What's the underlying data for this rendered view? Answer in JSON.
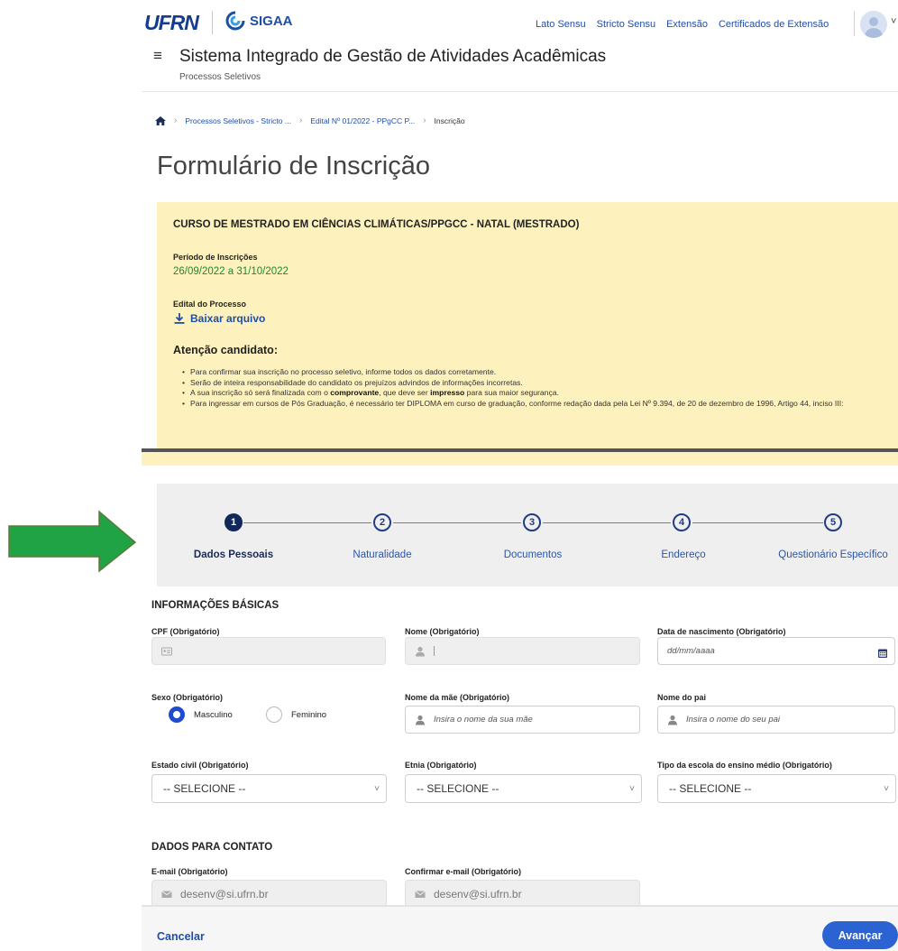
{
  "header": {
    "logo_ufrn": "UFRN",
    "logo_sigaa": "SIGAA",
    "nav_links": [
      "Lato Sensu",
      "Stricto Sensu",
      "Extensão",
      "Certificados de Extensão"
    ],
    "menu_glyph": "≡",
    "system_title": "Sistema Integrado de Gestão de Atividades Acadêmicas",
    "system_subtitle": "Processos Seletivos",
    "avatar_chevron": "˅"
  },
  "breadcrumb": {
    "items": [
      "Processos Seletivos - Stricto ...",
      "Edital Nº 01/2022 - PPgCC P...",
      "Inscrição"
    ]
  },
  "page_title": "Formulário de Inscrição",
  "notice": {
    "course": "CURSO DE MESTRADO EM CIÊNCIAS CLIMÁTICAS/PPGCC - NATAL (MESTRADO)",
    "period_label": "Período de Inscrições",
    "period_value": "26/09/2022 a 31/10/2022",
    "edital_label": "Edital do Processo",
    "download_label": "Baixar arquivo",
    "attention_title": "Atenção candidato:",
    "bullets": {
      "b1": "Para confirmar sua inscrição no processo seletivo, informe todos os dados corretamente.",
      "b2": "Serão de inteira responsabilidade do candidato os prejuízos advindos de informações incorretas.",
      "b3_pre": "A sua inscrição só será finalizada com o ",
      "b3_strong1": "comprovante",
      "b3_mid": ", que deve ser ",
      "b3_strong2": "impresso",
      "b3_post": " para sua maior segurança.",
      "b4": "Para ingressar em cursos de Pós Graduação, é necessário ter DIPLOMA em curso de graduação, conforme redação dada pela Lei Nº 9.394, de 20 de dezembro de 1996, Artigo 44, inciso III:"
    }
  },
  "stepper": {
    "steps": [
      {
        "number": "1",
        "label": "Dados Pessoais",
        "active": true
      },
      {
        "number": "2",
        "label": "Naturalidade",
        "active": false
      },
      {
        "number": "3",
        "label": "Documentos",
        "active": false
      },
      {
        "number": "4",
        "label": "Endereço",
        "active": false
      },
      {
        "number": "5",
        "label": "Questionário Específico",
        "active": false
      }
    ]
  },
  "form": {
    "basic_title": "INFORMAÇÕES BÁSICAS",
    "cpf_label": "CPF (Obrigatório)",
    "nome_label": "Nome (Obrigatório)",
    "nascimento_label": "Data de nascimento (Obrigatório)",
    "nascimento_placeholder": "dd/mm/aaaa",
    "sexo_label": "Sexo (Obrigatório)",
    "sexo_options": [
      "Masculino",
      "Feminino"
    ],
    "sexo_selected": "Masculino",
    "mae_label": "Nome da mãe (Obrigatório)",
    "mae_placeholder": "Insira o nome da sua mãe",
    "pai_label": "Nome do pai",
    "pai_placeholder": "Insira o nome do seu pai",
    "estado_label": "Estado civil (Obrigatório)",
    "etnia_label": "Etnia (Obrigatório)",
    "escola_label": "Tipo da escola do ensino médio (Obrigatório)",
    "select_value": "-- SELECIONE --",
    "contact_title": "DADOS PARA CONTATO",
    "email_label": "E-mail (Obrigatório)",
    "email_value": "desenv@si.ufrn.br",
    "confirm_email_label": "Confirmar e-mail (Obrigatório)",
    "confirm_email_value": "desenv@si.ufrn.br"
  },
  "footer": {
    "cancel_label": "Cancelar",
    "next_label": "Avançar"
  },
  "colors": {
    "brand_blue": "#1f4ea8",
    "notice_bg": "#fdf2bd",
    "period_green": "#1a8a2a",
    "primary_button": "#2c63d2",
    "annotation_arrow": "#1fa344"
  }
}
